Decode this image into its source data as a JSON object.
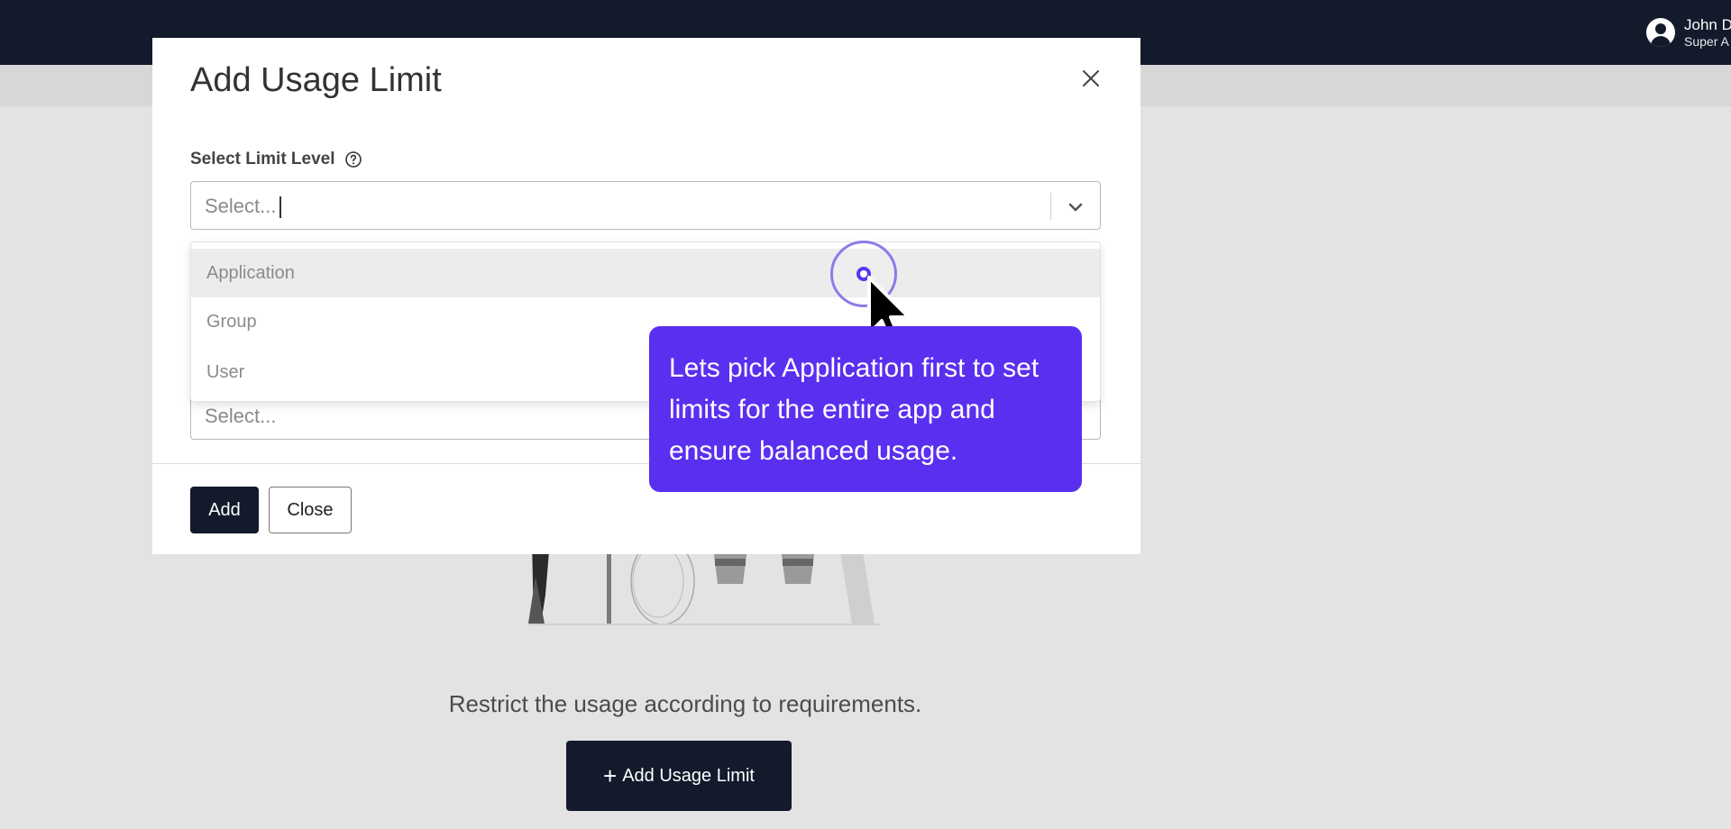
{
  "header": {
    "user_name": "John D",
    "user_role": "Super A"
  },
  "page": {
    "empty_message": "Restrict the usage according to requirements.",
    "add_usage_limit_label": "Add Usage Limit",
    "add_usage_limit_plus": "+"
  },
  "modal": {
    "title": "Add Usage Limit",
    "limit_level_label": "Select Limit Level",
    "limit_level_placeholder": "Select...",
    "options": [
      "Application",
      "Group",
      "User"
    ],
    "second_select_placeholder": "Select...",
    "add_label": "Add",
    "close_label": "Close"
  },
  "tooltip": {
    "text": "Lets pick Application first to set limits for the entire app and ensure balanced usage.",
    "accent_color": "#5a2ff0"
  },
  "icons": {
    "avatar": "user-circle-icon",
    "close": "close-icon",
    "help": "help-circle-icon",
    "dropdown": "chevron-down-icon",
    "cursor": "mouse-pointer-icon"
  }
}
